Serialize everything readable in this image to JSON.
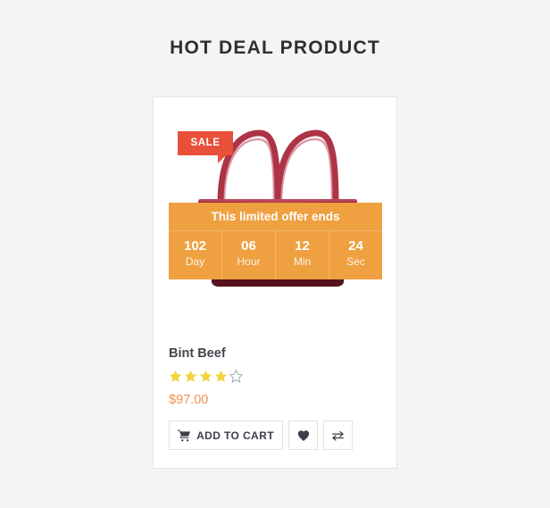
{
  "page": {
    "title": "HOT DEAL PRODUCT",
    "background_color": "#f4f4f4"
  },
  "product_card": {
    "badge": {
      "label": "SALE",
      "color": "#e8503a"
    },
    "image": {
      "icon_name": "handbag-image",
      "alt": "Burgundy leather handbag",
      "primary_color": "#7a1f2f",
      "handle_color": "#b5364a"
    },
    "countdown": {
      "heading": "This limited offer ends",
      "background_color": "#efa040",
      "units": [
        {
          "value": "102",
          "label": "Day"
        },
        {
          "value": "06",
          "label": "Hour"
        },
        {
          "value": "12",
          "label": "Min"
        },
        {
          "value": "24",
          "label": "Sec"
        }
      ]
    },
    "name": "Bint Beef",
    "rating": {
      "filled": 4,
      "total": 5,
      "star_color": "#f5d33c",
      "empty_star_color": "#8c97a5"
    },
    "price": "$97.00",
    "price_color": "#f0914a",
    "actions": {
      "add_to_cart": {
        "label": "ADD TO CART",
        "icon_name": "cart-icon"
      },
      "wishlist": {
        "icon_name": "heart-icon"
      },
      "compare": {
        "icon_name": "compare-icon"
      }
    }
  }
}
